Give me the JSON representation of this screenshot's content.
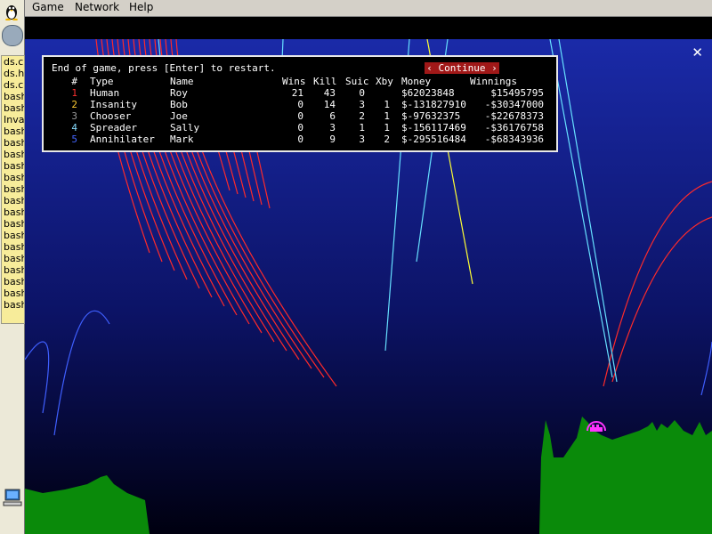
{
  "menubar": {
    "game": "Game",
    "network": "Network",
    "help": "Help"
  },
  "taskbar": {
    "tasks": [
      "ds.c",
      "ds.h",
      "ds.c",
      "bash",
      "bash",
      "Inva",
      "bash",
      "bash",
      "bash",
      "bash",
      "bash",
      "bash",
      "bash",
      "bash",
      "bash",
      "bash",
      "bash",
      "bash",
      "bash",
      "bash",
      "bash",
      "bash"
    ]
  },
  "dialog": {
    "message": "End of game, press [Enter] to restart.",
    "continue_label": "‹ Continue ›",
    "headers": {
      "num": "#",
      "type": "Type",
      "name": "Name",
      "wins": "Wins",
      "kill": "Kill",
      "suic": "Suic",
      "xby": "Xby",
      "money": "Money",
      "winnings": "Winnings"
    },
    "players": [
      {
        "num": "1",
        "color": "#ff3030",
        "type": "Human",
        "name": "Roy",
        "wins": "21",
        "kill": "43",
        "suic": "0",
        "xby": "",
        "money": "$62023848",
        "winnings": "$15495795"
      },
      {
        "num": "2",
        "color": "#ffcc33",
        "type": "Insanity",
        "name": "Bob",
        "wins": "0",
        "kill": "14",
        "suic": "3",
        "xby": "1",
        "money": "$-131827910",
        "winnings": "-$30347000"
      },
      {
        "num": "3",
        "color": "#999999",
        "type": "Chooser",
        "name": "Joe",
        "wins": "0",
        "kill": "6",
        "suic": "2",
        "xby": "1",
        "money": "$-97632375",
        "winnings": "-$22678373"
      },
      {
        "num": "4",
        "color": "#88ddff",
        "type": "Spreader",
        "name": "Sally",
        "wins": "0",
        "kill": "3",
        "suic": "1",
        "xby": "1",
        "money": "$-156117469",
        "winnings": "-$36176758"
      },
      {
        "num": "5",
        "color": "#4466ff",
        "type": "Annihilater",
        "name": "Mark",
        "wins": "0",
        "kill": "9",
        "suic": "3",
        "xby": "2",
        "money": "$-295516484",
        "winnings": "-$68343936"
      }
    ]
  },
  "colors": {
    "sky_top": "#1a2aa8",
    "sky_bottom": "#000010",
    "ground": "#0a8a0a",
    "tank": "#ff33ff"
  }
}
